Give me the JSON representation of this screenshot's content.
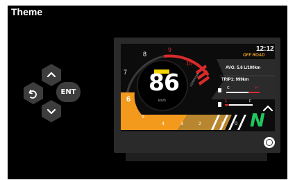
{
  "page": {
    "title": "Theme"
  },
  "controls": {
    "enter_label": "ENT"
  },
  "dashboard": {
    "time": "12:12",
    "mode": "OFF ROAD",
    "speed": "86",
    "speed_unit": "km/h",
    "rpm_unit": "x1000r/min",
    "avg": "AVG: 5.6 L/100km",
    "trip": "TRIP1: 999km",
    "temp_cold": "C",
    "temp_hot": "H",
    "fuel_empty": "E",
    "fuel_full": "F",
    "gear": "N",
    "rpm_ticks": [
      "1",
      "2",
      "3",
      "4",
      "5",
      "6",
      "7",
      "8",
      "9",
      "10"
    ],
    "gear_ticks": [
      "0",
      "1"
    ],
    "warning_badge": "",
    "colors": {
      "accent_orange": "#f39a1d",
      "redline": "#d92a2a",
      "gear_green": "#22c55e",
      "mode_orange": "#f5a623"
    }
  }
}
